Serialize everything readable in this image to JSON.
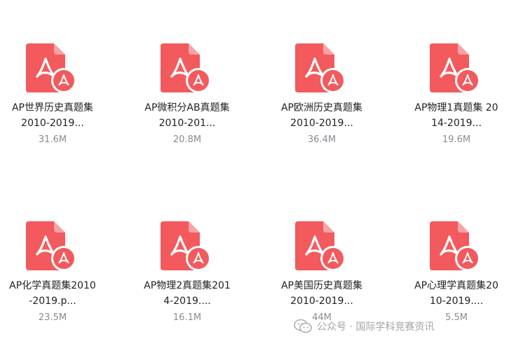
{
  "files": [
    {
      "name_line1": "AP世界历史真题集",
      "name_line2": "2010-2019...",
      "size": "31.6M"
    },
    {
      "name_line1": "AP微积分AB真题集",
      "name_line2": "2010-201...",
      "size": "20.8M"
    },
    {
      "name_line1": "AP欧洲历史真题集",
      "name_line2": "2010-2019...",
      "size": "36.4M"
    },
    {
      "name_line1": "AP物理1真题集 20",
      "name_line2": "14-2019...",
      "size": "19.6M"
    },
    {
      "name_line1": "AP化学真题集2010",
      "name_line2": "-2019.p...",
      "size": "23.5M"
    },
    {
      "name_line1": "AP物理2真题集201",
      "name_line2": "4-2019....",
      "size": "16.1M"
    },
    {
      "name_line1": "AP美国历史真题集",
      "name_line2": "2010-2019...",
      "size": "44M"
    },
    {
      "name_line1": "AP心理学真题集20",
      "name_line2": "10-2019....",
      "size": "5.5M"
    }
  ],
  "watermark": {
    "text": "公众号 · 国际学科竞赛资讯",
    "icon": "wechat-icon"
  },
  "colors": {
    "pdf_icon": "#f35a5d",
    "pdf_fold": "#f8a2a4",
    "name_text": "#222222",
    "size_text": "#888c93"
  }
}
